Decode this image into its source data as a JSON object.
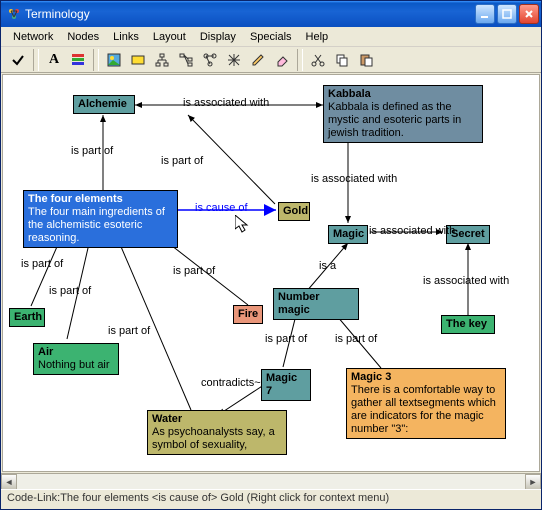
{
  "window": {
    "title": "Terminology"
  },
  "menu": {
    "items": [
      "Network",
      "Nodes",
      "Links",
      "Layout",
      "Display",
      "Specials",
      "Help"
    ]
  },
  "nodes": {
    "alchemie": {
      "title": "Alchemie"
    },
    "kabbala": {
      "title": "Kabbala",
      "desc": "Kabbala is defined as the mystic and esoteric parts in jewish tradition."
    },
    "four_elements": {
      "title": "The four elements",
      "desc": "The four main ingredients of the alchemistic esoteric reasoning."
    },
    "gold": {
      "title": "Gold"
    },
    "magic": {
      "title": "Magic"
    },
    "secret": {
      "title": "Secret"
    },
    "earth": {
      "title": "Earth"
    },
    "air": {
      "title": "Air",
      "desc": "Nothing but air"
    },
    "fire": {
      "title": "Fire"
    },
    "number_magic": {
      "title": "Number magic"
    },
    "the_key": {
      "title": "The key"
    },
    "water": {
      "title": "Water",
      "desc": "As psychoanalysts say, a symbol of sexuality,"
    },
    "magic7": {
      "title": "Magic 7"
    },
    "magic3": {
      "title": "Magic 3",
      "desc": "There is a comfortable way to gather all textsegments which are indicators for the magic number \"3\":"
    }
  },
  "edges": {
    "is_part_of": "is part of",
    "is_associated_with": "is associated with",
    "is_cause_of": "is cause of",
    "is_a": "is a",
    "contradicts": "contradicts~"
  },
  "status": {
    "text": "Code-Link:The four elements <is cause of> Gold (Right click for context menu)"
  }
}
